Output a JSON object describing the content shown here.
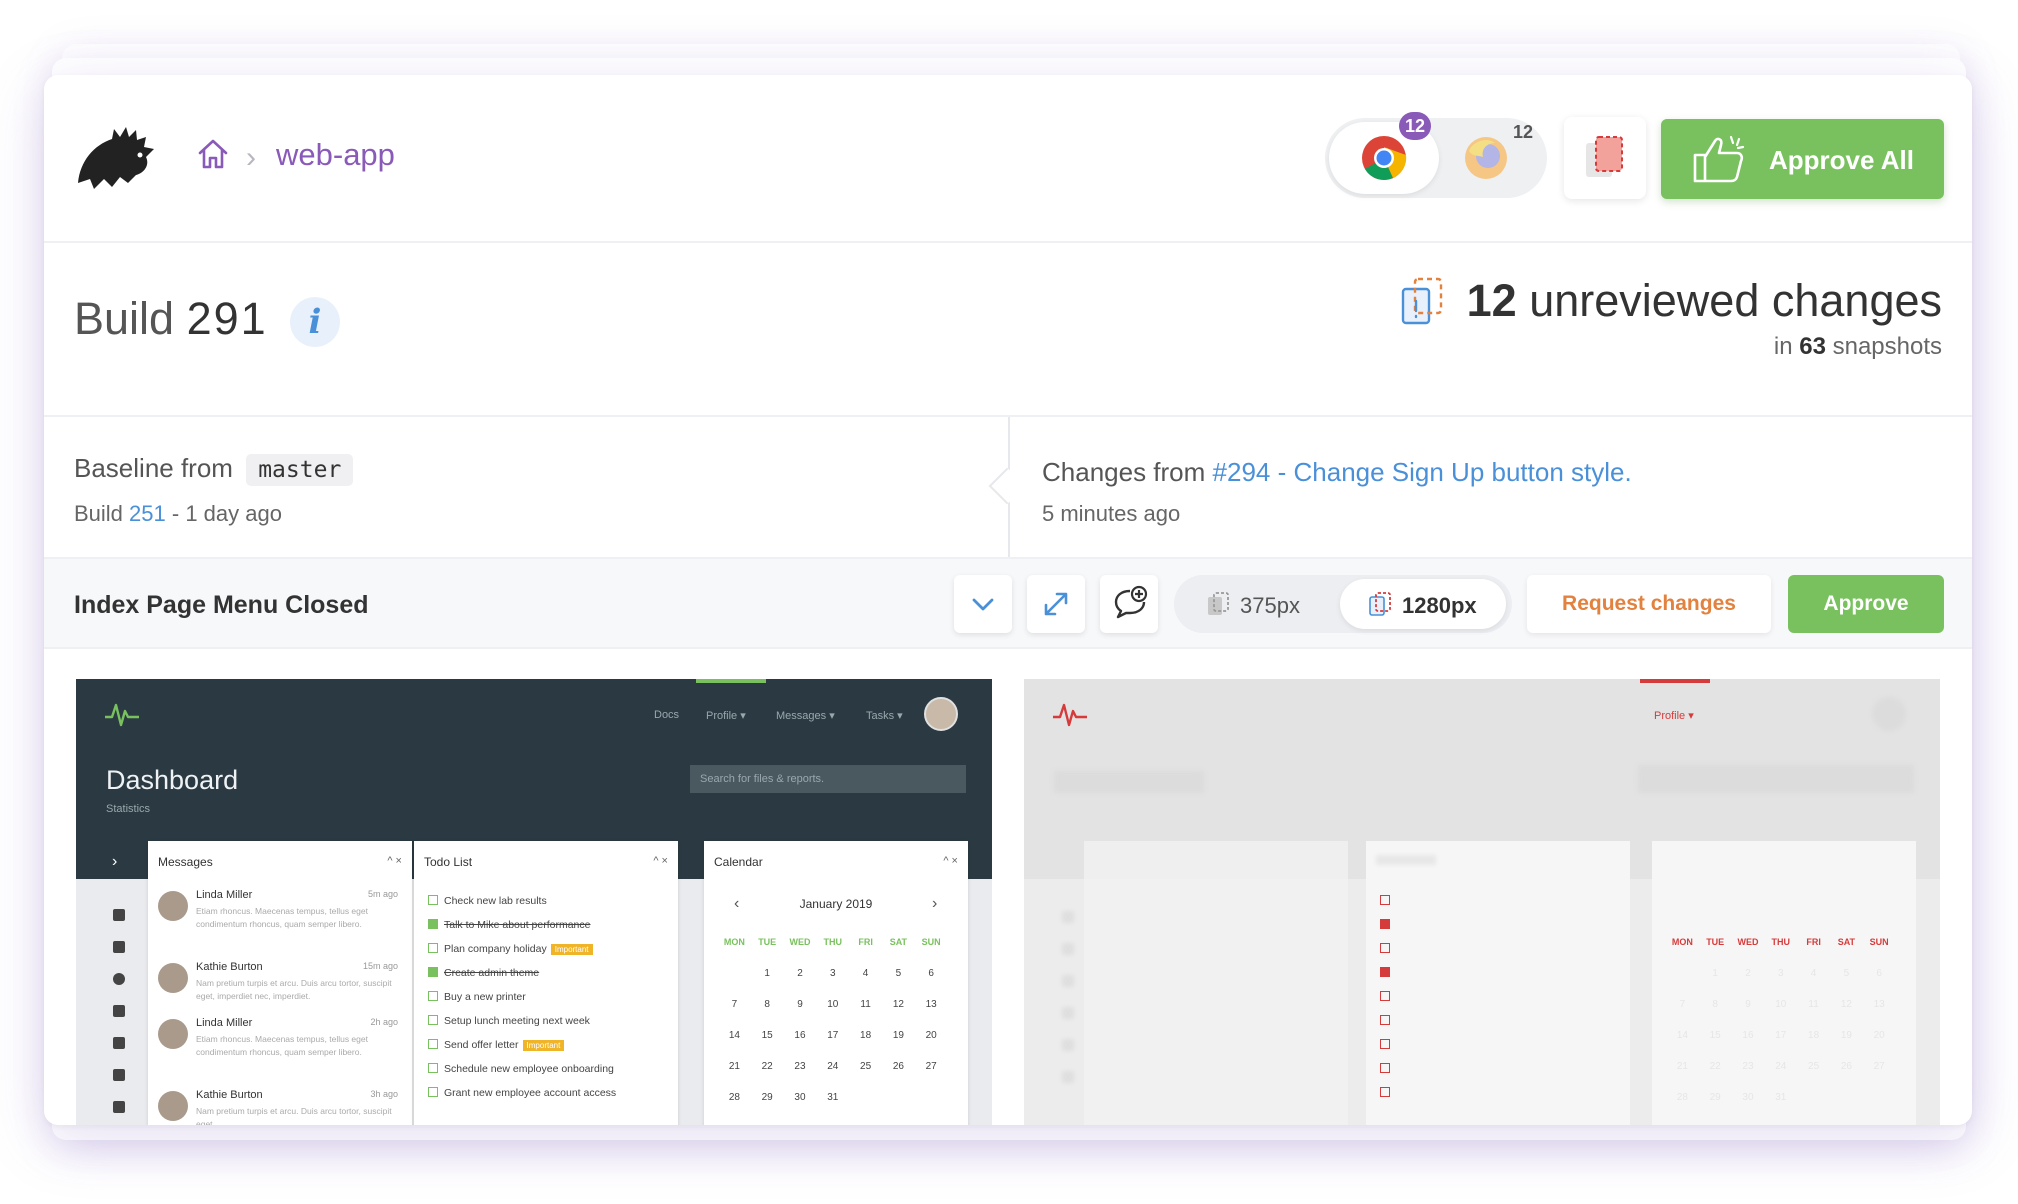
{
  "breadcrumb": {
    "project": "web-app"
  },
  "browsers": {
    "chrome_count": "12",
    "firefox_count": "12"
  },
  "header": {
    "approve_all": "Approve All"
  },
  "build": {
    "label": "Build",
    "number": "291",
    "info": "i"
  },
  "summary": {
    "count": "12",
    "text": "unreviewed changes",
    "in": "in",
    "snapshots": "63",
    "snapshots_label": "snapshots"
  },
  "baseline": {
    "label": "Baseline from",
    "branch": "master",
    "build_label": "Build",
    "build_number": "251",
    "age": "- 1 day ago"
  },
  "changes": {
    "label": "Changes from",
    "link": "#294 - Change Sign Up button style.",
    "age": "5 minutes ago"
  },
  "snapshot": {
    "title": "Index Page Menu Closed",
    "width_small": "375px",
    "width_large": "1280px",
    "width_selected": "1280px",
    "request_changes": "Request changes",
    "approve": "Approve"
  },
  "preview": {
    "nav": [
      "Docs",
      "Profile ▾",
      "Messages ▾",
      "Tasks ▾"
    ],
    "title": "Dashboard",
    "subtitle": "Statistics",
    "search_placeholder": "Search for files & reports.",
    "messages": {
      "title": "Messages",
      "controls": "^ ×",
      "items": [
        {
          "name": "Linda Miller",
          "time": "5m ago",
          "text": "Etiam rhoncus. Maecenas tempus, tellus eget condimentum rhoncus, quam semper libero."
        },
        {
          "name": "Kathie Burton",
          "time": "15m ago",
          "text": "Nam pretium turpis et arcu. Duis arcu tortor, suscipit eget, imperdiet nec, imperdiet."
        },
        {
          "name": "Linda Miller",
          "time": "2h ago",
          "text": "Etiam rhoncus. Maecenas tempus, tellus eget condimentum rhoncus, quam semper libero."
        },
        {
          "name": "Kathie Burton",
          "time": "3h ago",
          "text": "Nam pretium turpis et arcu. Duis arcu tortor, suscipit eget."
        }
      ]
    },
    "todo": {
      "title": "Todo List",
      "controls": "^ ×",
      "important": "Important",
      "items": [
        "Check new lab results",
        "Talk to Mike about performance",
        "Plan company holiday",
        "Create admin theme",
        "Buy a new printer",
        "Setup lunch meeting next week",
        "Send offer letter",
        "Schedule new employee onboarding",
        "Grant new employee account access"
      ]
    },
    "calendar": {
      "title": "Calendar",
      "controls": "^ ×",
      "month": "January 2019",
      "prev": "‹",
      "next": "›",
      "days": [
        "MON",
        "TUE",
        "WED",
        "THU",
        "FRI",
        "SAT",
        "SUN"
      ],
      "weeks": [
        [
          "",
          "1",
          "2",
          "3",
          "4",
          "5",
          "6"
        ],
        [
          "7",
          "8",
          "9",
          "10",
          "11",
          "12",
          "13"
        ],
        [
          "14",
          "15",
          "16",
          "17",
          "18",
          "19",
          "20"
        ],
        [
          "21",
          "22",
          "23",
          "24",
          "25",
          "26",
          "27"
        ],
        [
          "28",
          "29",
          "30",
          "31",
          "",
          "",
          ""
        ]
      ]
    },
    "diff_nav": "Profile ▾"
  },
  "colors": {
    "accent_purple": "#8a5ab8",
    "approve_green": "#79c15e",
    "request_orange": "#e3813e",
    "link_blue": "#4a90d9",
    "diff_red": "#d63b3b"
  }
}
